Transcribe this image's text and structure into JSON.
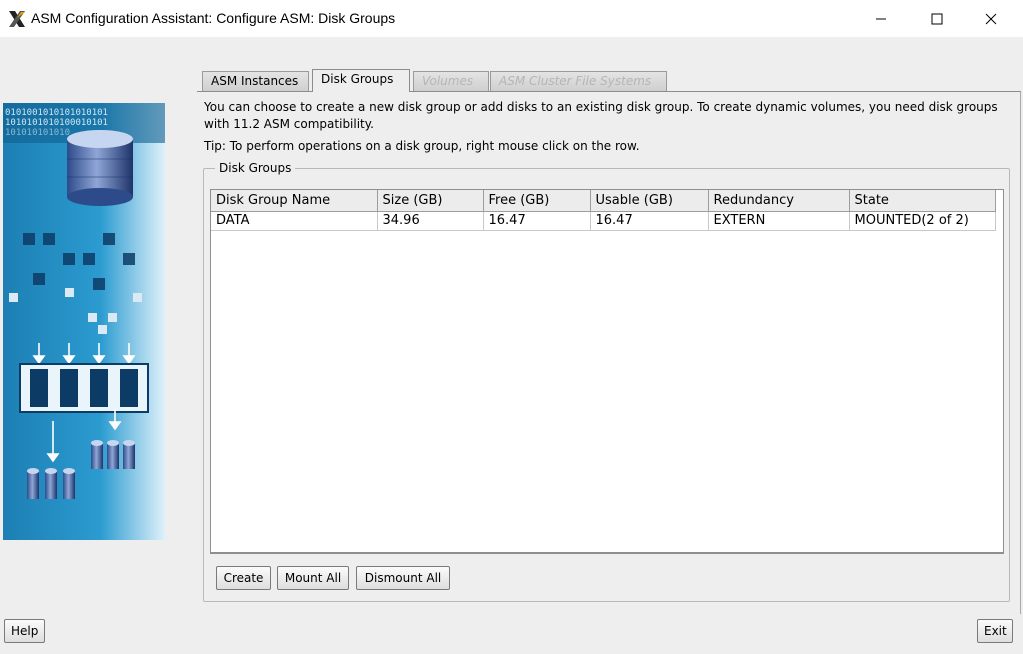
{
  "window": {
    "title": "ASM Configuration Assistant: Configure ASM: Disk Groups",
    "minimize_glyph": "—",
    "maximize_glyph": "☐",
    "close_glyph": "✕"
  },
  "tabs": [
    {
      "label": "ASM Instances",
      "state": "normal"
    },
    {
      "label": "Disk Groups",
      "state": "selected"
    },
    {
      "label": "Volumes",
      "state": "disabled"
    },
    {
      "label": "ASM Cluster File Systems",
      "state": "disabled"
    }
  ],
  "description": "You can choose to create a new disk group or add disks to an existing disk group. To create dynamic volumes, you need disk groups with 11.2 ASM compatibility.",
  "tip": "Tip: To perform operations on a disk group, right mouse click on the row.",
  "group_title": "Disk Groups",
  "table": {
    "columns": [
      "Disk Group Name",
      "Size (GB)",
      "Free (GB)",
      "Usable (GB)",
      "Redundancy",
      "State"
    ],
    "rows": [
      [
        "DATA",
        "34.96",
        "16.47",
        "16.47",
        "EXTERN",
        "MOUNTED(2 of 2)"
      ]
    ]
  },
  "actions": {
    "create": "Create",
    "mount_all": "Mount All",
    "dismount_all": "Dismount All"
  },
  "footer": {
    "help": "Help",
    "exit": "Exit"
  },
  "art": {
    "binary_line_1": "0101001010101010101",
    "binary_line_2": "1010101010100010101",
    "binary_line_3": "101010101010"
  },
  "colors": {
    "window_bg": "#eeeeee",
    "art_blue": "#1f8fc0",
    "disabled_text": "#b5b5b5"
  }
}
